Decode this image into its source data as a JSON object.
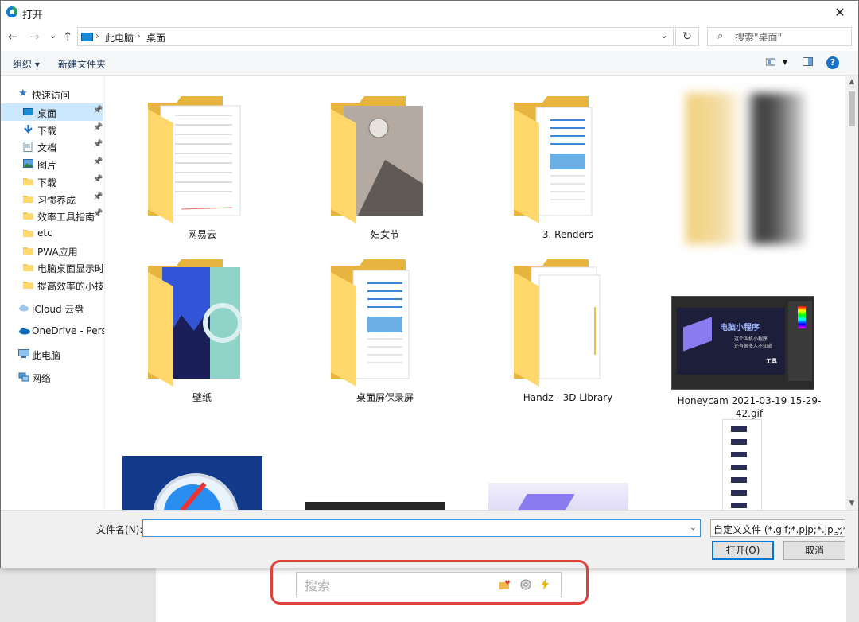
{
  "window": {
    "title": "打开",
    "close_glyph": "✕"
  },
  "nav": {
    "back_glyph": "←",
    "forward_glyph": "→",
    "recent_glyph": "⌄",
    "up_glyph": "↑",
    "breadcrumb": [
      "此电脑",
      "桌面"
    ],
    "breadcrumb_sep": "›",
    "refresh_glyph": "↻",
    "search_placeholder": "搜索\"桌面\""
  },
  "toolbar": {
    "organize_label": "组织 ▾",
    "new_folder_label": "新建文件夹",
    "help_glyph": "?"
  },
  "sidebar": {
    "quick_access_label": "快速访问",
    "items": [
      {
        "label": "桌面",
        "icon": "desktop-icon",
        "pinned": true,
        "selected": true
      },
      {
        "label": "下载",
        "icon": "download-icon",
        "pinned": true
      },
      {
        "label": "文档",
        "icon": "document-icon",
        "pinned": true
      },
      {
        "label": "图片",
        "icon": "pictures-icon",
        "pinned": true
      },
      {
        "label": "下载",
        "icon": "folder-icon",
        "pinned": true
      },
      {
        "label": "习惯养成",
        "icon": "folder-icon",
        "pinned": true
      },
      {
        "label": "效率工具指南",
        "icon": "folder-icon",
        "pinned": true
      },
      {
        "label": "etc",
        "icon": "folder-icon",
        "pinned": false
      },
      {
        "label": "PWA应用",
        "icon": "folder-icon",
        "pinned": false
      },
      {
        "label": "电脑桌面显示时间",
        "icon": "folder-icon",
        "pinned": false
      },
      {
        "label": "提高效率的小技巧",
        "icon": "folder-icon",
        "pinned": false
      }
    ],
    "groups": [
      {
        "label": "iCloud 云盘",
        "icon": "icloud-icon"
      },
      {
        "label": "OneDrive - Personal",
        "icon": "onedrive-icon"
      },
      {
        "label": "此电脑",
        "icon": "this-pc-icon"
      },
      {
        "label": "网络",
        "icon": "network-icon"
      }
    ]
  },
  "files": [
    {
      "name": "网易云",
      "kind": "folder-doc"
    },
    {
      "name": "妇女节",
      "kind": "folder-photo"
    },
    {
      "name": "3. Renders",
      "kind": "folder-generic"
    },
    {
      "name": "",
      "kind": "image-blurred"
    },
    {
      "name": "壁纸",
      "kind": "folder-wallpaper"
    },
    {
      "name": "桌面屏保录屏",
      "kind": "folder-generic"
    },
    {
      "name": "Handz - 3D Library",
      "kind": "folder-white"
    },
    {
      "name": "Honeycam 2021-03-19 15-29-42.gif",
      "kind": "image-screenshot",
      "thumb_text": "电脑小程序",
      "thumb_sub": "这个叫机小程序\n还有很多人不知道",
      "thumb_tag": "工具"
    },
    {
      "name": "",
      "kind": "image-safari"
    },
    {
      "name": "",
      "kind": "image-dark"
    },
    {
      "name": "",
      "kind": "image-purple"
    },
    {
      "name": "",
      "kind": "image-long"
    }
  ],
  "footer": {
    "filename_label": "文件名(N):",
    "filename_value": "",
    "filter_label": "自定义文件 (*.gif;*.pjp;*.jpg;*.",
    "open_label": "打开(O)",
    "cancel_label": "取消"
  },
  "bottom_search": {
    "placeholder": "搜索"
  }
}
